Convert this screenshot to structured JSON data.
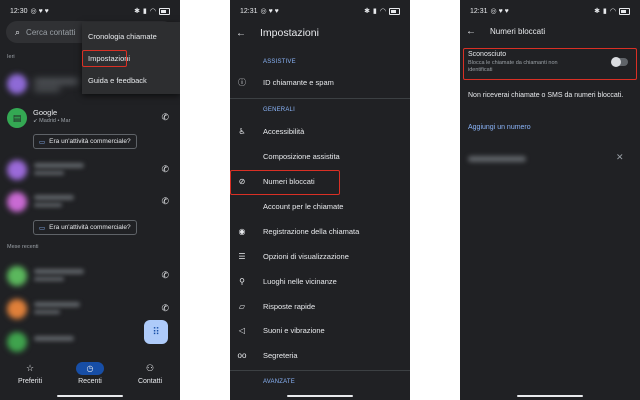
{
  "phone1": {
    "status": {
      "time": "12:30",
      "icons": "◎ ♥ ♥"
    },
    "search_placeholder": "Cerca contatti",
    "section_recent": "Ieri",
    "section_older": "Mese recenti",
    "contact_name": "Google",
    "contact_detail": "Madrid • Mar",
    "chip_label": "Era un'attività commerciale?",
    "menu": [
      "Cronologia chiamate",
      "Impostazioni",
      "Guida e feedback"
    ],
    "nav": {
      "favorites": "Preferiti",
      "recents": "Recenti",
      "contacts": "Contatti"
    }
  },
  "phone2": {
    "status": {
      "time": "12:31",
      "icons": "◎ ♥ ♥"
    },
    "title": "Impostazioni",
    "section_assistive": "ASSISTIVE",
    "section_general": "GENERALI",
    "section_advanced": "AVANZATE",
    "items": {
      "caller_id": "ID chiamante e spam",
      "accessibility": "Accessibilità",
      "assisted_dialing": "Composizione assistita",
      "blocked_numbers": "Numeri bloccati",
      "calling_accounts": "Account per le chiamate",
      "call_recording": "Registrazione della chiamata",
      "display_options": "Opzioni di visualizzazione",
      "nearby_places": "Luoghi nelle vicinanze",
      "quick_responses": "Risposte rapide",
      "sounds_vibration": "Suoni e vibrazione",
      "voicemail": "Segreteria"
    }
  },
  "phone3": {
    "status": {
      "time": "12:31",
      "icons": "◎ ♥ ♥"
    },
    "title": "Numeri bloccati",
    "unknown_title": "Sconosciuto",
    "unknown_subtitle": "Blocca le chiamate da chiamanti non identificati",
    "info_text": "Non riceverai chiamate o SMS da numeri bloccati.",
    "add_number": "Aggiungi un numero",
    "unknown_toggle_on": false
  }
}
